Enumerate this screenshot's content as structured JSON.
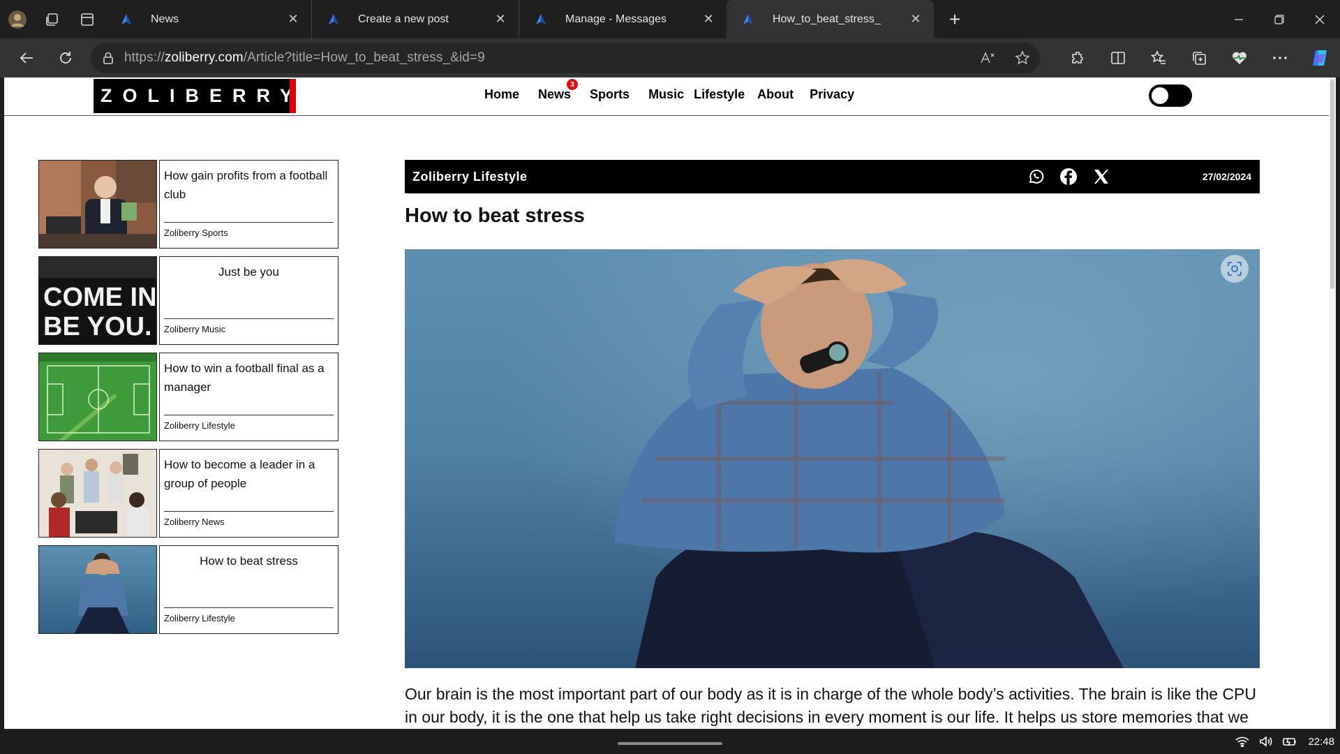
{
  "browser": {
    "tabs": [
      {
        "title": "News",
        "active": false
      },
      {
        "title": "Create a new post",
        "active": false
      },
      {
        "title": "Manage - Messages",
        "active": false
      },
      {
        "title": "How_to_beat_stress_",
        "active": true
      }
    ],
    "url_prefix": "https://",
    "url_host": "zoliberry.com",
    "url_path": "/Article?title=How_to_beat_stress_&id=9"
  },
  "site": {
    "logo": "ZOLIBERRY",
    "nav": [
      "Home",
      "News",
      "Sports",
      "Music",
      "Lifestyle",
      "About",
      "Privacy"
    ],
    "news_badge": "3"
  },
  "sidebar": [
    {
      "title": "How gain profits from a football club",
      "category": "Zoliberry Sports",
      "thumb": "businessman-money"
    },
    {
      "title": "Just be you",
      "category": "Zoliberry Music",
      "thumb": "come-in-be-you-sign"
    },
    {
      "title": "How to win a football final as a manager",
      "category": "Zoliberry Lifestyle",
      "thumb": "football-pitch"
    },
    {
      "title": "How to become a leader in a group of people",
      "category": "Zoliberry News",
      "thumb": "group-of-people"
    },
    {
      "title": "How to beat stress",
      "category": "Zoliberry Lifestyle",
      "thumb": "stressed-man"
    }
  ],
  "article": {
    "source": "Zoliberry Lifestyle",
    "date": "27/02/2024",
    "title": "How to beat stress",
    "body": "Our brain is the most important part of our body as it is in charge of the whole body’s activities. The brain is like the CPU in our body, it is the one that help us take right decisions in every moment is our life. It helps us store memories that we"
  },
  "taskbar": {
    "time": "22:48"
  }
}
